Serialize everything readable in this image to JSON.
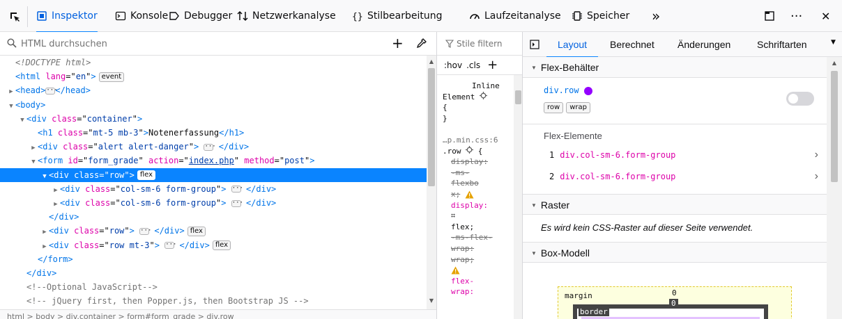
{
  "toolbar": {
    "tabs": [
      {
        "label": "Inspektor",
        "icon": "inspector-icon",
        "active": true
      },
      {
        "label": "Konsole",
        "icon": "console-icon"
      },
      {
        "label": "Debugger",
        "icon": "debugger-icon"
      },
      {
        "label": "Netzwerkanalyse",
        "icon": "network-icon"
      },
      {
        "label": "Stilbearbeitung",
        "icon": "style-editor-icon"
      },
      {
        "label": "Laufzeitanalyse",
        "icon": "performance-icon"
      },
      {
        "label": "Speicher",
        "icon": "memory-icon"
      }
    ],
    "overflow": "»",
    "more": "···",
    "close": "✕"
  },
  "markup": {
    "search_placeholder": "HTML durchsuchen",
    "rows": [
      {
        "type": "doctype",
        "indent": 0,
        "text": "<!DOCTYPE html>"
      },
      {
        "type": "open",
        "indent": 0,
        "tag": "html",
        "attrs": [
          {
            "name": "lang",
            "value": "en"
          }
        ],
        "badge": "event"
      },
      {
        "type": "collapsed-small",
        "indent": 0,
        "tag": "head",
        "twisty": "▶"
      },
      {
        "type": "open",
        "indent": 0,
        "tag": "body",
        "twisty": "▼",
        "attrs": []
      },
      {
        "type": "open",
        "indent": 1,
        "tag": "div",
        "twisty": "▼",
        "attrs": [
          {
            "name": "class",
            "value": "container"
          }
        ]
      },
      {
        "type": "inline",
        "indent": 2,
        "tag": "h1",
        "attrs": [
          {
            "name": "class",
            "value": "mt-5 mb-3"
          }
        ],
        "content": "Notenerfassung"
      },
      {
        "type": "collapsed",
        "indent": 2,
        "tag": "div",
        "twisty": "▶",
        "attrs": [
          {
            "name": "class",
            "value": "alert alert-danger"
          }
        ]
      },
      {
        "type": "open",
        "indent": 2,
        "tag": "form",
        "twisty": "▼",
        "attrs": [
          {
            "name": "id",
            "value": "form_grade"
          },
          {
            "name": "action",
            "value": "index.php",
            "link": true
          },
          {
            "name": "method",
            "value": "post"
          }
        ]
      },
      {
        "type": "open",
        "indent": 3,
        "tag": "div",
        "twisty": "▼",
        "attrs": [
          {
            "name": "class",
            "value": "row"
          }
        ],
        "badge": "flex",
        "selected": true
      },
      {
        "type": "collapsed",
        "indent": 4,
        "tag": "div",
        "twisty": "▶",
        "attrs": [
          {
            "name": "class",
            "value": "col-sm-6 form-group"
          }
        ]
      },
      {
        "type": "collapsed",
        "indent": 4,
        "tag": "div",
        "twisty": "▶",
        "attrs": [
          {
            "name": "class",
            "value": "col-sm-6 form-group"
          }
        ]
      },
      {
        "type": "close",
        "indent": 3,
        "tag": "div"
      },
      {
        "type": "collapsed",
        "indent": 3,
        "tag": "div",
        "twisty": "▶",
        "attrs": [
          {
            "name": "class",
            "value": "row"
          }
        ],
        "badge": "flex"
      },
      {
        "type": "collapsed",
        "indent": 3,
        "tag": "div",
        "twisty": "▶",
        "attrs": [
          {
            "name": "class",
            "value": "row mt-3"
          }
        ],
        "badge": "flex"
      },
      {
        "type": "close",
        "indent": 2,
        "tag": "form"
      },
      {
        "type": "close",
        "indent": 1,
        "tag": "div"
      },
      {
        "type": "comment",
        "indent": 1,
        "text": "<!--Optional JavaScript-->"
      },
      {
        "type": "comment",
        "indent": 1,
        "text": "<!-- jQuery first, then Popper.js, then Bootstrap JS -->"
      }
    ],
    "breadcrumbs": "html  >  body  >  div.container  >  form#form_grade  >  div.row"
  },
  "rules": {
    "filter_placeholder": "Stile filtern",
    "hov": ":hov",
    "cls": ".cls",
    "add": "+",
    "lines": [
      {
        "text": "Inline",
        "cls": "val",
        "indent": 7
      },
      {
        "text": "Element",
        "cls": "val",
        "gear": true,
        "indent": 0
      },
      {
        "text": "{",
        "cls": "val",
        "indent": 0
      },
      {
        "text": "}",
        "cls": "val",
        "indent": 0
      },
      {
        "text": "",
        "cls": "val",
        "indent": 0
      },
      {
        "text": "…p.min.css:6",
        "cls": "comment",
        "indent": 0
      },
      {
        "text": ".row",
        "cls": "val",
        "gear": true,
        "brace": "{",
        "indent": 0
      },
      {
        "text": "display:",
        "cls": "prop-dis",
        "indent": 2
      },
      {
        "text": "-ms-",
        "cls": "val-dis",
        "indent": 2
      },
      {
        "text": "flexbo",
        "cls": "val-dis",
        "indent": 2
      },
      {
        "text": "x;",
        "cls": "val-dis",
        "warn": true,
        "indent": 2
      },
      {
        "text": "display:",
        "cls": "prop",
        "indent": 2
      },
      {
        "text": "⌗",
        "cls": "val",
        "indent": 2
      },
      {
        "text": "flex;",
        "cls": "val",
        "indent": 2
      },
      {
        "text": "-ms-flex-",
        "cls": "prop-dis",
        "indent": 2
      },
      {
        "text": "wrap:",
        "cls": "prop-dis",
        "indent": 2
      },
      {
        "text": "wrap;",
        "cls": "val-dis",
        "indent": 2
      },
      {
        "text": "",
        "cls": "val",
        "warn": true,
        "indent": 2
      },
      {
        "text": "flex-",
        "cls": "prop",
        "indent": 2
      },
      {
        "text": "wrap:",
        "cls": "prop",
        "indent": 2
      }
    ]
  },
  "sidebar": {
    "tabs": [
      {
        "label": "Layout",
        "active": true
      },
      {
        "label": "Berechnet"
      },
      {
        "label": "Änderungen"
      },
      {
        "label": "Schriftarten"
      }
    ],
    "flex_container": {
      "heading": "Flex-Behälter",
      "element": "div.row",
      "dot_color": "#9400ff",
      "chips": [
        "row",
        "wrap"
      ]
    },
    "flex_items": {
      "heading": "Flex-Elemente",
      "items": [
        {
          "num": "1",
          "selector": "div.col-sm-6.form-group"
        },
        {
          "num": "2",
          "selector": "div.col-sm-6.form-group"
        }
      ]
    },
    "grid": {
      "heading": "Raster",
      "message": "Es wird kein CSS-Raster auf dieser Seite verwendet."
    },
    "box_model": {
      "heading": "Box-Modell",
      "margin_label": "margin",
      "margin_value": "0",
      "border_label": "border",
      "border_value": "0"
    }
  },
  "colors": {
    "accent": "#0a84ff",
    "tag": "#0074e8",
    "attr_name": "#dd00a9",
    "attr_value": "#003eaa"
  }
}
